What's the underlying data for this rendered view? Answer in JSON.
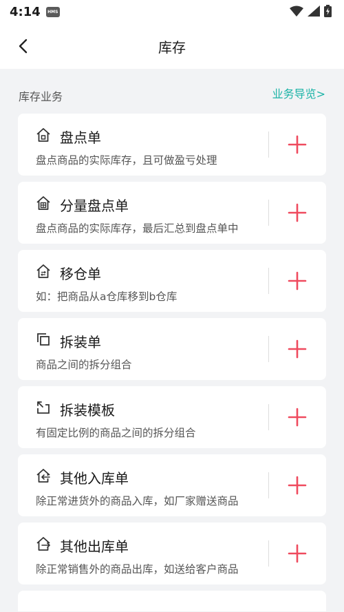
{
  "status_bar": {
    "time": "4:14",
    "hms_badge": "HMS"
  },
  "header": {
    "title": "库存"
  },
  "section": {
    "label": "库存业务",
    "guide_link": "业务导览>"
  },
  "colors": {
    "accent": "#1ab3a6",
    "add_button": "#ef4a5e",
    "icon": "#333333"
  },
  "items": [
    {
      "name": "盘点单",
      "desc": "盘点商品的实际库存，且可做盈亏处理",
      "icon": "house-icon"
    },
    {
      "name": "分量盘点单",
      "desc": "盘点商品的实际库存，最后汇总到盘点单中",
      "icon": "house-grid-icon"
    },
    {
      "name": "移仓单",
      "desc": "如：把商品从a仓库移到b仓库",
      "icon": "house-arrows-icon"
    },
    {
      "name": "拆装单",
      "desc": "商品之间的拆分组合",
      "icon": "copy-squares-icon"
    },
    {
      "name": "拆装模板",
      "desc": "有固定比例的商品之间的拆分组合",
      "icon": "corner-arrow-icon"
    },
    {
      "name": "其他入库单",
      "desc": "除正常进货外的商品入库，如厂家赠送商品",
      "icon": "house-in-icon"
    },
    {
      "name": "其他出库单",
      "desc": "除正常销售外的商品出库，如送给客户商品",
      "icon": "house-out-icon"
    }
  ]
}
